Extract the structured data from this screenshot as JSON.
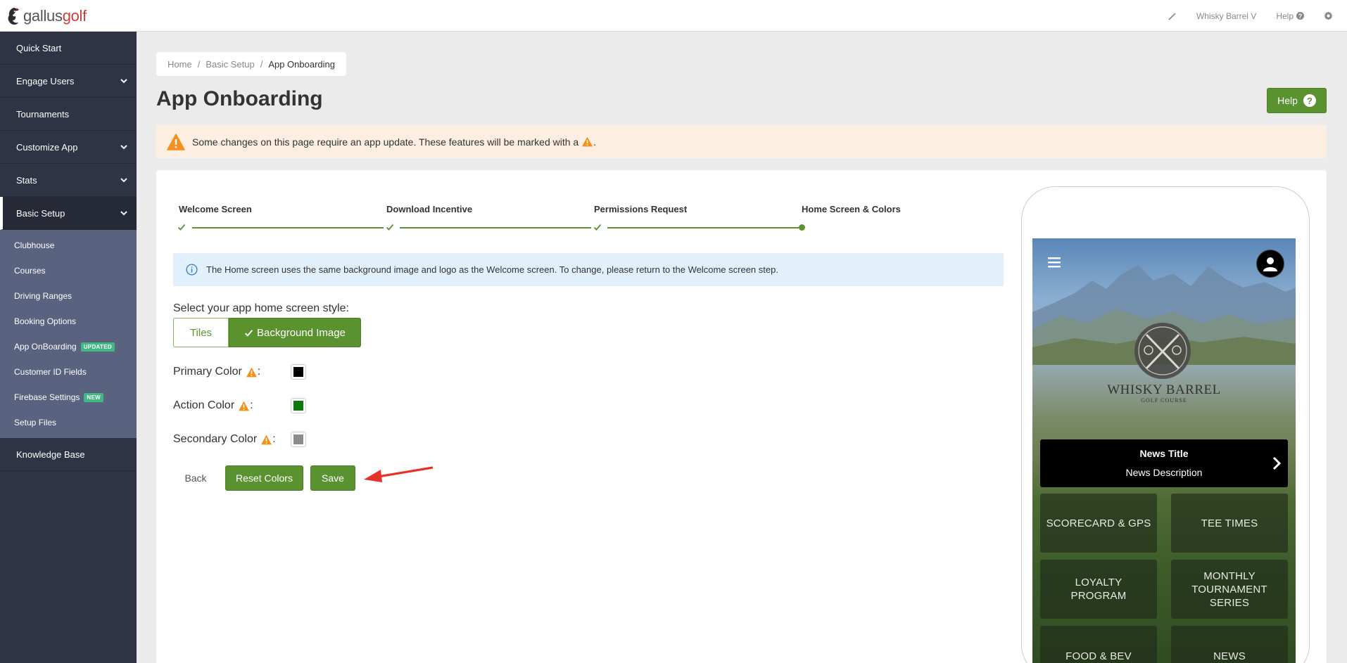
{
  "brand": {
    "name_part1": "gallus",
    "name_part2": "golf"
  },
  "topbar": {
    "account": "Whisky Barrel V",
    "help": "Help",
    "help_mark": "?"
  },
  "sidebar": {
    "items": [
      {
        "label": "Quick Start"
      },
      {
        "label": "Engage Users"
      },
      {
        "label": "Tournaments"
      },
      {
        "label": "Customize App"
      },
      {
        "label": "Stats"
      },
      {
        "label": "Basic Setup"
      }
    ],
    "subitems": [
      {
        "label": "Clubhouse"
      },
      {
        "label": "Courses"
      },
      {
        "label": "Driving Ranges"
      },
      {
        "label": "Booking Options"
      },
      {
        "label": "App OnBoarding",
        "badge": "UPDATED"
      },
      {
        "label": "Customer ID Fields"
      },
      {
        "label": "Firebase Settings",
        "badge": "NEW"
      },
      {
        "label": "Setup Files"
      }
    ],
    "after": {
      "label": "Knowledge Base"
    }
  },
  "breadcrumb": {
    "home": "Home",
    "sep": "/",
    "basic_setup": "Basic Setup",
    "current": "App Onboarding"
  },
  "page": {
    "title": "App Onboarding",
    "help_label": "Help",
    "help_mark": "?",
    "warning": "Some changes on this page require an app update. These features will be marked with a",
    "warning_end": "."
  },
  "steps": [
    {
      "label": "Welcome Screen"
    },
    {
      "label": "Download Incentive"
    },
    {
      "label": "Permissions Request"
    },
    {
      "label": "Home Screen & Colors"
    }
  ],
  "info": "The Home screen uses the same background image and logo as the Welcome screen. To change, please return to the Welcome screen step.",
  "style": {
    "label": "Select your app home screen style:",
    "tiles": "Tiles",
    "background_image": "Background Image"
  },
  "colors": {
    "primary_label": "Primary Color",
    "action_label": "Action Color",
    "secondary_label": "Secondary Color",
    "colon": ":",
    "primary": "#000000",
    "action": "#0b7a0b",
    "secondary": "#8c8c8c"
  },
  "buttons": {
    "back": "Back",
    "reset": "Reset Colors",
    "save": "Save"
  },
  "theme": {
    "accent": "#5b9230",
    "sidebar": "#2f3444",
    "subnav": "#59627e",
    "warning_bg": "#fcefe1",
    "info_bg": "#e2f0fb"
  },
  "preview": {
    "course_name": "WHISKY BARREL",
    "course_sub": "GOLF COURSE",
    "news_title": "News Title",
    "news_desc": "News Description",
    "tiles": [
      {
        "line1": "SCORECARD & GPS"
      },
      {
        "line1": "TEE TIMES"
      },
      {
        "line1": "LOYALTY",
        "line2": "PROGRAM"
      },
      {
        "line1": "MONTHLY",
        "line2": "TOURNAMENT",
        "line3": "SERIES"
      },
      {
        "line1": "FOOD & BEV"
      },
      {
        "line1": "NEWS"
      }
    ]
  }
}
